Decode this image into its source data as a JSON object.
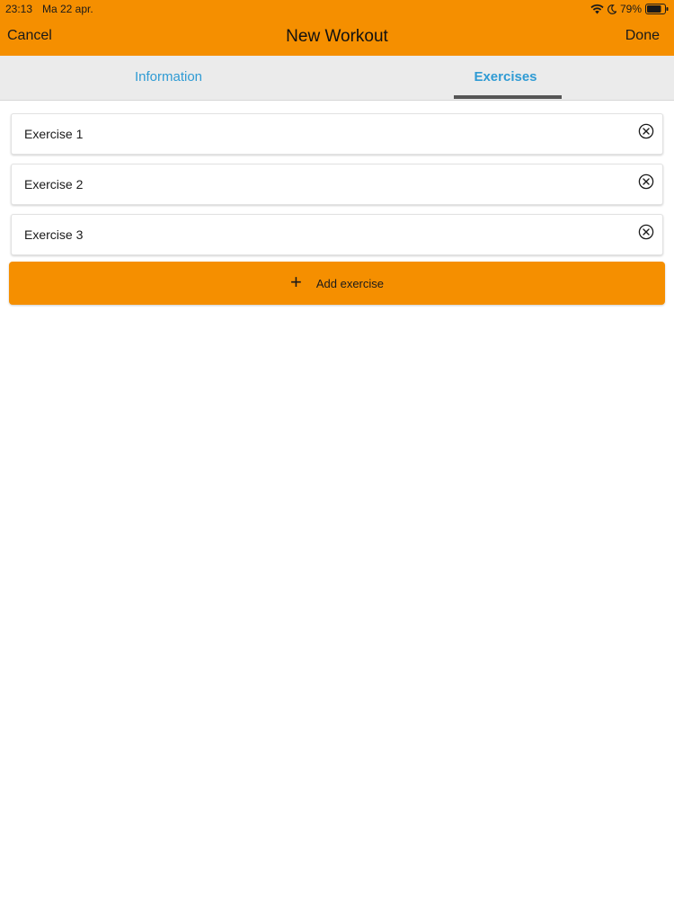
{
  "status_bar": {
    "time": "23:13",
    "date": "Ma 22 apr.",
    "battery_percent": "79%",
    "icons": [
      "wifi-icon",
      "moon-icon",
      "battery-icon"
    ]
  },
  "nav": {
    "cancel_label": "Cancel",
    "title": "New Workout",
    "done_label": "Done"
  },
  "tabs": [
    {
      "label": "Information",
      "selected": false
    },
    {
      "label": "Exercises",
      "selected": true
    }
  ],
  "exercises": [
    {
      "name": "Exercise 1",
      "remove_icon": "close-circle-icon"
    },
    {
      "name": "Exercise 2",
      "remove_icon": "close-circle-icon"
    },
    {
      "name": "Exercise 3",
      "remove_icon": "close-circle-icon"
    }
  ],
  "add_button": {
    "icon": "plus-icon",
    "label": "Add exercise"
  },
  "colors": {
    "accent": "#f58f00",
    "tab_text": "#2f9bd4",
    "tab_background": "#ebebeb"
  }
}
